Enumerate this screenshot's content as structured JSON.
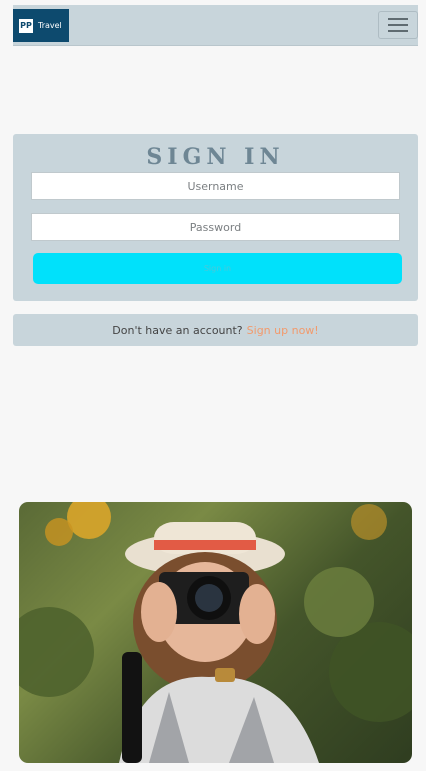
{
  "navbar": {
    "logo_mark": "PP",
    "logo_text": "Travel"
  },
  "signin": {
    "title": "SIGN IN",
    "username_placeholder": "Username",
    "password_placeholder": "Password",
    "button_label": "Sign in"
  },
  "signup": {
    "prompt": "Don't have an account?",
    "link_label": "Sign up now!"
  },
  "colors": {
    "panel": "#c8d5db",
    "brand": "#0d4a6e",
    "button": "#00e1fb",
    "link": "#f29a6c"
  }
}
